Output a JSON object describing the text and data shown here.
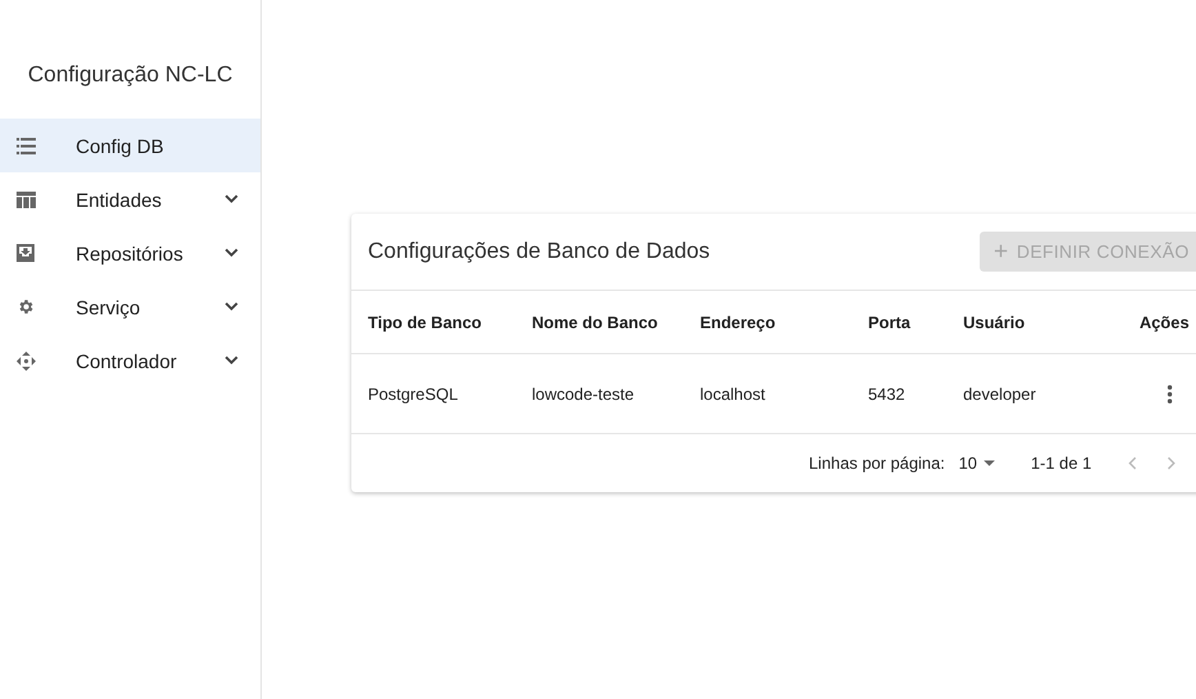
{
  "sidebar": {
    "title": "Configuração NC-LC",
    "items": [
      {
        "label": "Config DB",
        "selected": true,
        "kind": "link"
      },
      {
        "label": "Entidades",
        "selected": false,
        "kind": "group",
        "expanded": false
      },
      {
        "label": "Repositórios",
        "selected": false,
        "kind": "group",
        "expanded": false
      },
      {
        "label": "Serviço",
        "selected": false,
        "kind": "group",
        "expanded": false
      },
      {
        "label": "Controlador",
        "selected": false,
        "kind": "group",
        "expanded": false
      }
    ]
  },
  "card": {
    "title": "Configurações de Banco de Dados",
    "add_button": {
      "icon": "+",
      "label": "DEFINIR CONEXÃO",
      "disabled": true
    },
    "table": {
      "columns": [
        "Tipo de Banco",
        "Nome do Banco",
        "Endereço",
        "Porta",
        "Usuário",
        "Ações"
      ],
      "rows": [
        [
          "PostgreSQL",
          "lowcode-teste",
          "localhost",
          "5432",
          "developer"
        ]
      ]
    },
    "pagination": {
      "rows_label": "Linhas por página:",
      "rows_per_page": "10",
      "range": "1-1 de 1",
      "prev_disabled": true,
      "next_disabled": true
    }
  }
}
